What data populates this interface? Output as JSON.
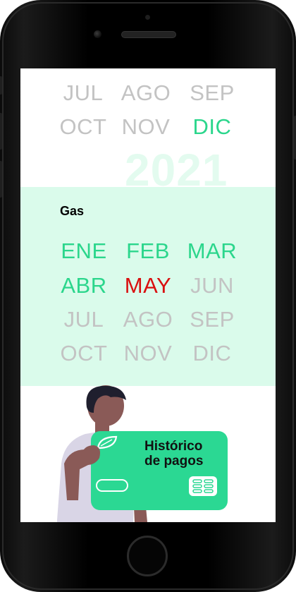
{
  "upper_calendar": {
    "rows": [
      [
        {
          "label": "JUL",
          "state": "inactive"
        },
        {
          "label": "AGO",
          "state": "inactive"
        },
        {
          "label": "SEP",
          "state": "inactive"
        }
      ],
      [
        {
          "label": "OCT",
          "state": "inactive"
        },
        {
          "label": "NOV",
          "state": "inactive"
        },
        {
          "label": "DIC",
          "state": "paid"
        }
      ]
    ],
    "year": "2021"
  },
  "gas_section": {
    "title": "Gas",
    "rows": [
      [
        {
          "label": "ENE",
          "state": "paid"
        },
        {
          "label": "FEB",
          "state": "paid"
        },
        {
          "label": "MAR",
          "state": "paid"
        }
      ],
      [
        {
          "label": "ABR",
          "state": "paid"
        },
        {
          "label": "MAY",
          "state": "current"
        },
        {
          "label": "JUN",
          "state": "inactive"
        }
      ],
      [
        {
          "label": "JUL",
          "state": "inactive"
        },
        {
          "label": "AGO",
          "state": "inactive"
        },
        {
          "label": "SEP",
          "state": "inactive"
        }
      ],
      [
        {
          "label": "OCT",
          "state": "inactive"
        },
        {
          "label": "NOV",
          "state": "inactive"
        },
        {
          "label": "DIC",
          "state": "inactive"
        }
      ]
    ]
  },
  "history_card": {
    "title_line1": "Histórico",
    "title_line2": "de pagos",
    "icons": [
      "leaf-icon",
      "toggle-pill-icon",
      "chip-icon"
    ]
  },
  "colors": {
    "paid": "#2bd68c",
    "current": "#d90f0f",
    "inactive": "#c3c3c3",
    "band": "#dafbeb",
    "card": "#2bd893"
  }
}
